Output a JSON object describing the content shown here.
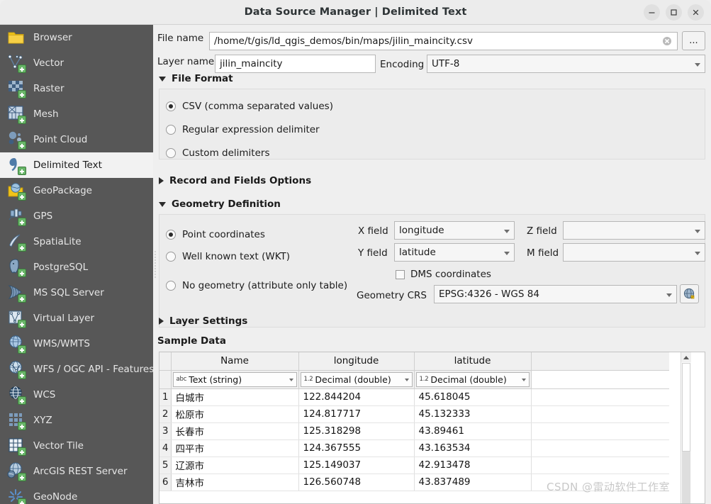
{
  "window": {
    "title": "Data Source Manager | Delimited Text",
    "minimize_label": "–",
    "maximize_label": "□",
    "close_label": "×"
  },
  "sidebar": {
    "items": [
      {
        "label": "Browser",
        "icon": "browser-folder-icon",
        "selected": false
      },
      {
        "label": "Vector",
        "icon": "vector-icon",
        "selected": false
      },
      {
        "label": "Raster",
        "icon": "raster-icon",
        "selected": false
      },
      {
        "label": "Mesh",
        "icon": "mesh-icon",
        "selected": false
      },
      {
        "label": "Point Cloud",
        "icon": "point-cloud-icon",
        "selected": false
      },
      {
        "label": "Delimited Text",
        "icon": "delimited-text-icon",
        "selected": true
      },
      {
        "label": "GeoPackage",
        "icon": "geopackage-icon",
        "selected": false
      },
      {
        "label": "GPS",
        "icon": "gps-icon",
        "selected": false
      },
      {
        "label": "SpatiaLite",
        "icon": "spatialite-icon",
        "selected": false
      },
      {
        "label": "PostgreSQL",
        "icon": "postgresql-icon",
        "selected": false
      },
      {
        "label": "MS SQL Server",
        "icon": "mssql-server-icon",
        "selected": false
      },
      {
        "label": "Virtual Layer",
        "icon": "virtual-layer-icon",
        "selected": false
      },
      {
        "label": "WMS/WMTS",
        "icon": "wms-wmts-icon",
        "selected": false
      },
      {
        "label": "WFS / OGC API - Features",
        "icon": "wfs-ogc-api-icon",
        "selected": false
      },
      {
        "label": "WCS",
        "icon": "wcs-icon",
        "selected": false
      },
      {
        "label": "XYZ",
        "icon": "xyz-icon",
        "selected": false
      },
      {
        "label": "Vector Tile",
        "icon": "vector-tile-icon",
        "selected": false
      },
      {
        "label": "ArcGIS REST Server",
        "icon": "arcgis-rest-icon",
        "selected": false
      },
      {
        "label": "GeoNode",
        "icon": "geonode-icon",
        "selected": false
      }
    ]
  },
  "form": {
    "file_name_label": "File name",
    "file_name_value": "/home/t/gis/ld_qgis_demos/bin/maps/jilin_maincity.csv",
    "browse_button_label": "...",
    "layer_name_label": "Layer name",
    "layer_name_value": "jilin_maincity",
    "encoding_label": "Encoding",
    "encoding_value": "UTF-8"
  },
  "file_format": {
    "title": "File Format",
    "expanded": true,
    "options": [
      {
        "label": "CSV (comma separated values)",
        "selected": true
      },
      {
        "label": "Regular expression delimiter",
        "selected": false
      },
      {
        "label": "Custom delimiters",
        "selected": false
      }
    ]
  },
  "record_fields": {
    "title": "Record and Fields Options",
    "expanded": false
  },
  "geometry": {
    "title": "Geometry Definition",
    "expanded": true,
    "options": [
      {
        "label": "Point coordinates",
        "selected": true
      },
      {
        "label": "Well known text (WKT)",
        "selected": false
      },
      {
        "label": "No geometry (attribute only table)",
        "selected": false
      }
    ],
    "x_field_label": "X field",
    "x_field_value": "longitude",
    "y_field_label": "Y field",
    "y_field_value": "latitude",
    "z_field_label": "Z field",
    "z_field_value": "",
    "m_field_label": "M field",
    "m_field_value": "",
    "dms_label": "DMS coordinates",
    "dms_checked": false,
    "crs_label": "Geometry CRS",
    "crs_value": "EPSG:4326 - WGS 84"
  },
  "layer_settings": {
    "title": "Layer Settings",
    "expanded": false
  },
  "sample_data": {
    "title": "Sample Data",
    "columns": [
      "Name",
      "longitude",
      "latitude"
    ],
    "types": [
      {
        "badge": "abc",
        "label": "Text (string)"
      },
      {
        "badge": "1.2",
        "label": "Decimal (double)"
      },
      {
        "badge": "1.2",
        "label": "Decimal (double)"
      }
    ],
    "rows": [
      {
        "n": "1",
        "cells": [
          "白城市",
          "122.844204",
          "45.618045"
        ]
      },
      {
        "n": "2",
        "cells": [
          "松原市",
          "124.817717",
          "45.132333"
        ]
      },
      {
        "n": "3",
        "cells": [
          "长春市",
          "125.318298",
          "43.89461"
        ]
      },
      {
        "n": "4",
        "cells": [
          "四平市",
          "124.367555",
          "43.163534"
        ]
      },
      {
        "n": "5",
        "cells": [
          "辽源市",
          "125.149037",
          "42.913478"
        ]
      },
      {
        "n": "6",
        "cells": [
          "吉林市",
          "126.560748",
          "43.837489"
        ]
      }
    ]
  },
  "watermark": {
    "text": "CSDN @雷动软件工作室"
  },
  "colors": {
    "sidebar_bg": "#575757",
    "panel_bg": "#efefef",
    "selected_bg": "#f2f2f2",
    "accent_green": "#68b568"
  }
}
